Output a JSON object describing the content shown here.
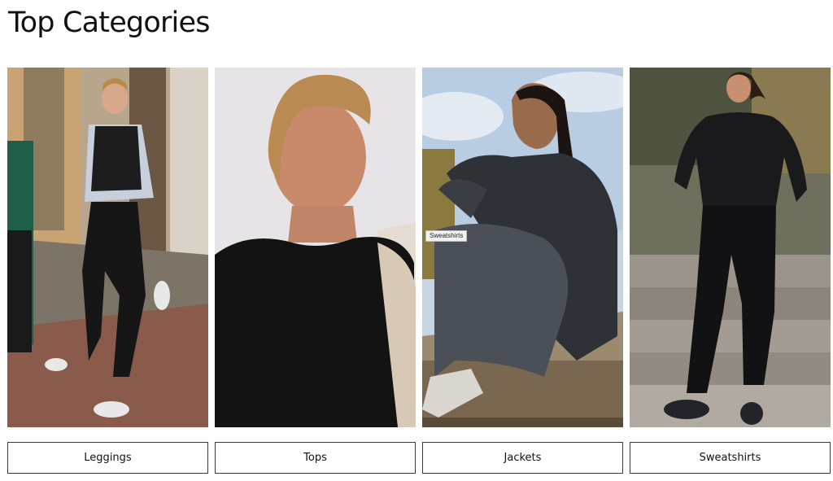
{
  "section": {
    "title": "Top Categories"
  },
  "categories": [
    {
      "label": "Leggings",
      "image": "woman-running-in-leggings-photo"
    },
    {
      "label": "Tops",
      "image": "woman-in-black-top-portrait-photo"
    },
    {
      "label": "Jackets",
      "image": "woman-in-black-jacket-seated-photo",
      "tooltip": "Sweatshirts"
    },
    {
      "label": "Sweatshirts",
      "image": "woman-in-black-sweatshirt-on-steps-photo"
    }
  ],
  "colors": {
    "button_border": "#3a3a3a",
    "text": "#111111",
    "background": "#ffffff"
  }
}
